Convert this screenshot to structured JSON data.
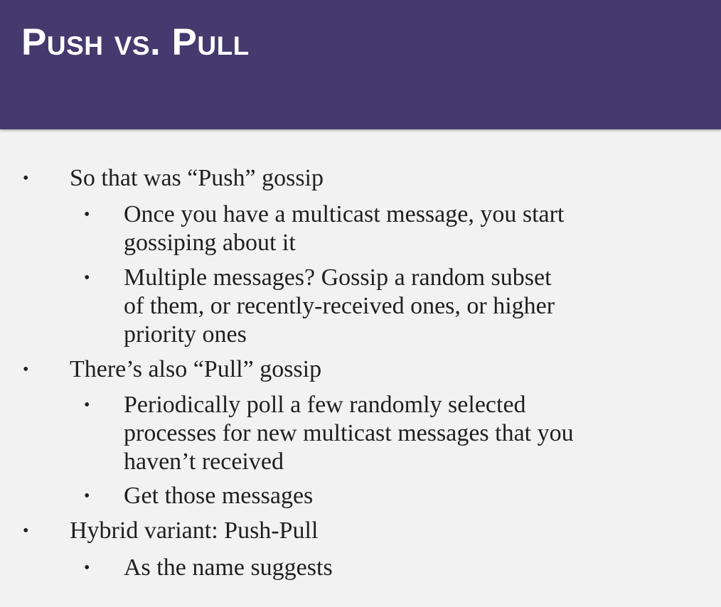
{
  "slide": {
    "title": "Push vs. Pull",
    "bullet_glyph": "•",
    "bullets": [
      {
        "text": "So that was “Push” gossip"
      },
      {
        "text": "Once you have a multicast message, you start",
        "cont": "gossiping about it"
      },
      {
        "text": "Multiple messages? Gossip a random subset",
        "cont": "of them, or recently-received ones, or higher",
        "cont2": "priority ones"
      },
      {
        "text": "There’s also “Pull” gossip"
      },
      {
        "text": "Periodically poll a few randomly selected",
        "cont": "processes for new multicast messages that you",
        "cont2": "haven’t received"
      },
      {
        "text": "Get those messages"
      },
      {
        "text": "Hybrid variant: Push-Pull"
      },
      {
        "text": "As the name suggests"
      }
    ]
  },
  "colors": {
    "header_bg": "#443a6e",
    "title_text": "#ffffff",
    "body_bg": "#f1f2f1",
    "body_text": "#1f1f1f"
  }
}
